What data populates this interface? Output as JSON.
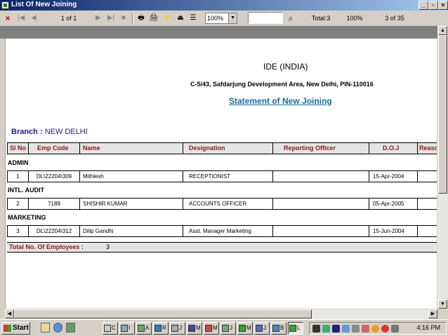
{
  "window": {
    "title": "List Of New Joining"
  },
  "toolbar": {
    "page_indicator": "1 of 1",
    "zoom": "100%",
    "search_value": "",
    "total": "Total:3",
    "percent": "100%",
    "record_pos": "3 of 35"
  },
  "report": {
    "company": "IDE (INDIA)",
    "address": "C-5/43, Safdarjung Development Area, New Delhi,  PIN-110016",
    "statement_title": "Statement of New Joining",
    "branch_label": "Branch :",
    "branch_value": "NEW DELHI",
    "columns": [
      "Sl No",
      "Emp Code",
      "Name",
      "Designation",
      "Reporting Officer",
      "D.O.J",
      "Reason"
    ],
    "groups": [
      {
        "name": "ADMIN",
        "rows": [
          {
            "sl": "1",
            "code": "DL\\22204\\309",
            "name": "Mithlesh",
            "designation": "RECEPTIONIST",
            "officer": "",
            "doj": "15-Apr-2004",
            "reason": ""
          }
        ]
      },
      {
        "name": "INTL. AUDIT",
        "rows": [
          {
            "sl": "2",
            "code": "7188",
            "name": "SHISHIR KUMAR",
            "designation": "ACCOUNTS OFFICER",
            "officer": "",
            "doj": "05-Apr-2005",
            "reason": ""
          }
        ]
      },
      {
        "name": "MARKETING",
        "rows": [
          {
            "sl": "3",
            "code": "DL\\22204\\312",
            "name": "Dilip Gandhi",
            "designation": "Asst. Manager Marketing",
            "officer": "",
            "doj": "15-Jun-2004",
            "reason": ""
          }
        ]
      }
    ],
    "total_label": "Total No. Of Employees :",
    "total_value": "3"
  },
  "taskbar": {
    "start_label": "Start",
    "tasks": [
      "C",
      "I",
      "A",
      "R",
      "J",
      "M",
      "M",
      "J",
      "M",
      "J",
      "B",
      "L"
    ],
    "clock": "4:16 PM"
  }
}
